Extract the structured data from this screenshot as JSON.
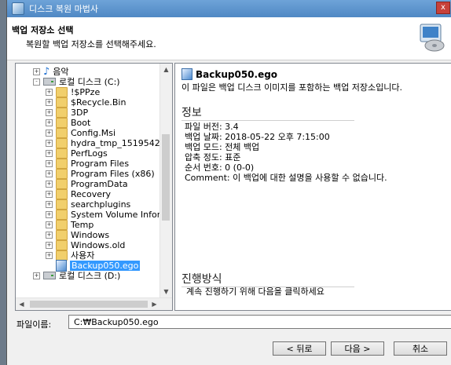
{
  "window": {
    "title": "디스크 복원 마법사",
    "close_label": "x"
  },
  "header": {
    "title": "백업 저장소 선택",
    "subtitle": "복원할 백업 저장소를 선택해주세요."
  },
  "tree": {
    "items": [
      {
        "label": "음악",
        "type": "music",
        "expander": "+"
      },
      {
        "label": "로컬 디스크 (C:)",
        "type": "drive",
        "expander": "-"
      },
      {
        "label": "!$PPze",
        "type": "folder",
        "expander": "+"
      },
      {
        "label": "$Recycle.Bin",
        "type": "folder",
        "expander": "+"
      },
      {
        "label": "3DP",
        "type": "folder",
        "expander": "+"
      },
      {
        "label": "Boot",
        "type": "folder",
        "expander": "+"
      },
      {
        "label": "Config.Msi",
        "type": "folder",
        "expander": "+"
      },
      {
        "label": "hydra_tmp_151954215",
        "type": "folder",
        "expander": "+"
      },
      {
        "label": "PerfLogs",
        "type": "folder",
        "expander": "+"
      },
      {
        "label": "Program Files",
        "type": "folder",
        "expander": "+"
      },
      {
        "label": "Program Files (x86)",
        "type": "folder",
        "expander": "+"
      },
      {
        "label": "ProgramData",
        "type": "folder",
        "expander": "+"
      },
      {
        "label": "Recovery",
        "type": "folder",
        "expander": "+"
      },
      {
        "label": "searchplugins",
        "type": "folder",
        "expander": "+"
      },
      {
        "label": "System Volume Inforr",
        "type": "folder",
        "expander": "+"
      },
      {
        "label": "Temp",
        "type": "folder",
        "expander": "+"
      },
      {
        "label": "Windows",
        "type": "folder",
        "expander": "+"
      },
      {
        "label": "Windows.old",
        "type": "folder",
        "expander": "+"
      },
      {
        "label": "사용자",
        "type": "folder",
        "expander": "+"
      },
      {
        "label": "Backup050.ego",
        "type": "file",
        "expander": ""
      },
      {
        "label": "로컬 디스크 (D:)",
        "type": "drive",
        "expander": "+"
      }
    ]
  },
  "info": {
    "file_title": "Backup050.ego",
    "description": "이 파일은 백업 디스크 이미지를 포함하는 백업 저장소입니다.",
    "section_info": "정보",
    "details": [
      "파일 버전:  3.4",
      "백업 날짜:  2018-05-22 오후 7:15:00",
      "백업 모드:  전체 백업",
      "압축 정도:  표준",
      "순서 번호:  0 (0-0)",
      "Comment:  이 백업에 대한 설명을 사용할 수 없습니다."
    ],
    "section_progress": "진행방식",
    "progress_note": "계속 진행하기 위해 다음을 클릭하세요"
  },
  "footer": {
    "filename_label": "파일이름:",
    "filename_value": "C:₩Backup050.ego",
    "back_button": "< 뒤로",
    "next_button": "다음 >",
    "cancel_button": "취소"
  }
}
